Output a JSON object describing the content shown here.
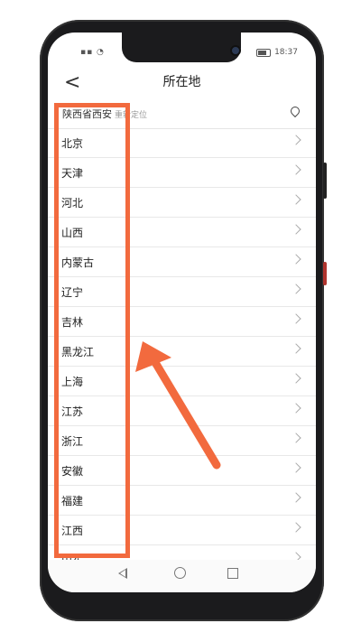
{
  "status": {
    "time": "18:37"
  },
  "header": {
    "back_label": "<",
    "title": "所在地"
  },
  "locate": {
    "text": "陕西省西安",
    "hint": "重新定位"
  },
  "provinces": [
    "北京",
    "天津",
    "河北",
    "山西",
    "内蒙古",
    "辽宁",
    "吉林",
    "黑龙江",
    "上海",
    "江苏",
    "浙江",
    "安徽",
    "福建",
    "江西",
    "山东"
  ],
  "colors": {
    "annotation": "#f26a3e"
  },
  "icons": {
    "back": "back-arrow-icon",
    "pin": "location-pin-icon",
    "chevron": "chevron-right-icon"
  }
}
